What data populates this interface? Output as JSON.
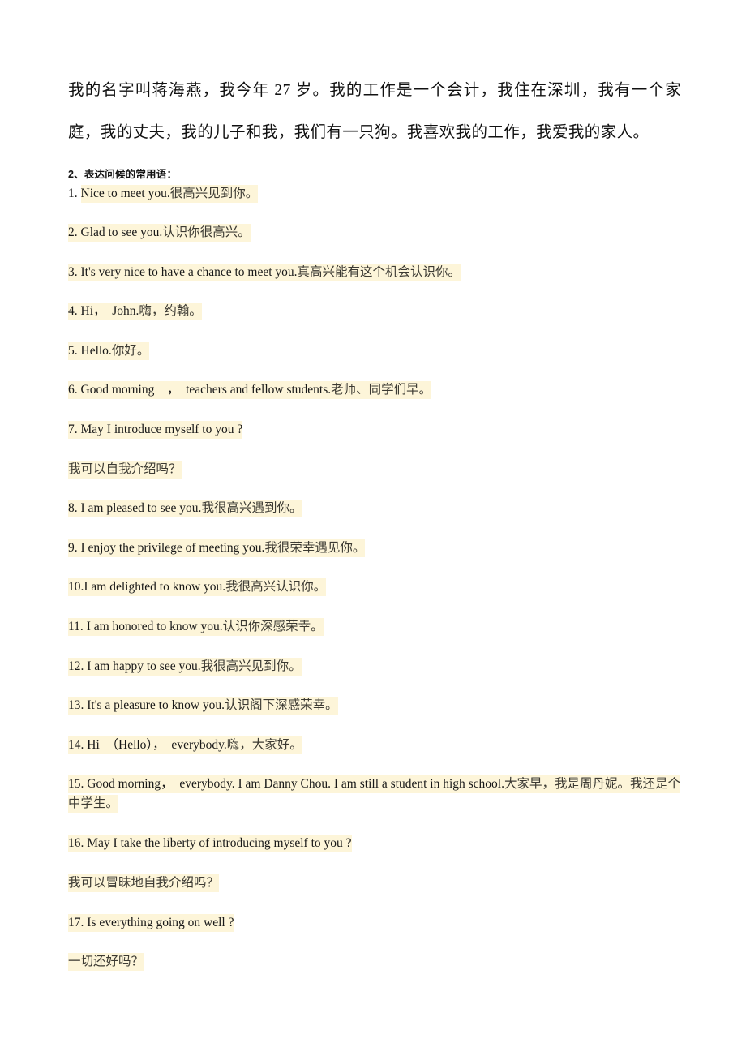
{
  "document": {
    "intro_paragraph": "我的名字叫蒋海燕，我今年 27 岁。我的工作是一个会计，我住在深圳，我有一个家庭，我的丈夫，我的儿子和我，我们有一只狗。我喜欢我的工作，我爱我的家人。",
    "section_heading": "2、表达问候的常用语：",
    "highlight_color": "#fdf5d9",
    "phrases": [
      {
        "id": 1,
        "number": "1.",
        "number_highlighted": false,
        "lead_space": "",
        "english": "Nice to meet you.",
        "chinese": "很高兴见到你。",
        "wrapped": false
      },
      {
        "id": 2,
        "number": "2.",
        "number_highlighted": true,
        "lead_space": "      ",
        "english": "Glad to see you.",
        "chinese": "认识你很高兴。",
        "wrapped": false
      },
      {
        "id": 3,
        "number": "3.",
        "number_highlighted": true,
        "lead_space": "      ",
        "english": "It's very nice to have a chance to meet you.",
        "chinese": "真高兴能有这个机会认识你。",
        "wrapped": false
      },
      {
        "id": 4,
        "number": "4.",
        "number_highlighted": true,
        "lead_space": "     ",
        "english": "Hi，　John.",
        "chinese": "嗨，约翰。",
        "wrapped": false
      },
      {
        "id": 5,
        "number": "5.",
        "number_highlighted": true,
        "lead_space": "     ",
        "english": "Hello.",
        "chinese": "你好。",
        "wrapped": false
      },
      {
        "id": 6,
        "number": "6.",
        "number_highlighted": true,
        "lead_space": "    ",
        "english": "Good morning　，　teachers and fellow students.",
        "chinese": "老师、同学们早。",
        "wrapped": false
      },
      {
        "id": 7,
        "number": "7.",
        "number_highlighted": true,
        "lead_space": "    ",
        "english": "May I introduce myself to you ?",
        "chinese": "",
        "wrapped": false
      },
      {
        "id": "7b",
        "number": "",
        "number_highlighted": true,
        "lead_space": "    ",
        "english": "",
        "chinese": "我可以自我介绍吗？",
        "wrapped": false
      },
      {
        "id": 8,
        "number": "8.",
        "number_highlighted": true,
        "lead_space": "     ",
        "english": "I am pleased to see you.",
        "chinese": "我很高兴遇到你。",
        "wrapped": false
      },
      {
        "id": 9,
        "number": "9.",
        "number_highlighted": true,
        "lead_space": "     ",
        "english": "I enjoy the privilege of meeting you.",
        "chinese": "我很荣幸遇见你。",
        "wrapped": false
      },
      {
        "id": 10,
        "number": "10.",
        "number_highlighted": true,
        "lead_space": "     ",
        "english": "I am delighted to know you.",
        "chinese": "我很高兴认识你。",
        "wrapped": false,
        "no_space_after_number": true
      },
      {
        "id": 11,
        "number": "11.",
        "number_highlighted": true,
        "lead_space": "     ",
        "english": "I am honored to know you.",
        "chinese": "认识你深感荣幸。",
        "wrapped": false
      },
      {
        "id": 12,
        "number": "12.",
        "number_highlighted": true,
        "lead_space": "      ",
        "english": "I am happy to see you.",
        "chinese": "我很高兴见到你。",
        "wrapped": false
      },
      {
        "id": 13,
        "number": "13.",
        "number_highlighted": true,
        "lead_space": "      ",
        "english": "It's a pleasure to know you.",
        "chinese": "认识阁下深感荣幸。",
        "wrapped": false
      },
      {
        "id": 14,
        "number": "14.",
        "number_highlighted": true,
        "lead_space": "     ",
        "english": "Hi　（Hello），　everybody.",
        "chinese": "嗨，大家好。",
        "wrapped": false
      },
      {
        "id": 15,
        "number": "15.",
        "number_highlighted": true,
        "lead_space": "    ",
        "english": "Good morning，　everybody. I am Danny Chou. I am still a student in high school.",
        "chinese": "大家早，我是周丹妮。我还是个中学生。",
        "wrapped": true
      },
      {
        "id": 16,
        "number": "16.",
        "number_highlighted": true,
        "lead_space": "    ",
        "english": "May I take the liberty of introducing myself to you ?",
        "chinese": "",
        "wrapped": false
      },
      {
        "id": "16b",
        "number": "",
        "number_highlighted": true,
        "lead_space": "    ",
        "english": "",
        "chinese": "我可以冒昧地自我介绍吗？",
        "wrapped": false
      },
      {
        "id": 17,
        "number": "17.",
        "number_highlighted": true,
        "lead_space": "    ",
        "english": "Is everything going on well ?",
        "chinese": "",
        "wrapped": false
      },
      {
        "id": "17b",
        "number": "",
        "number_highlighted": true,
        "lead_space": "    ",
        "english": "",
        "chinese": "一切还好吗？",
        "wrapped": false
      }
    ]
  }
}
